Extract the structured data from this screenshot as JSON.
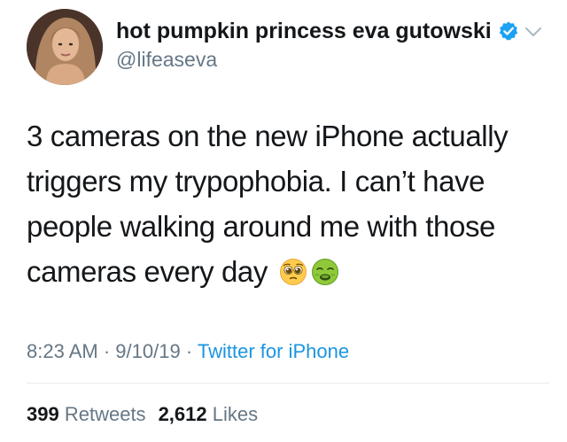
{
  "user": {
    "display_name": "hot pumpkin princess eva gutowski",
    "handle": "@lifeaseva",
    "verified": true,
    "verified_color": "#1da1f2"
  },
  "tweet": {
    "lines": [
      "3 cameras on the new iPhone actually",
      "triggers my trypophobia. I can’t have",
      "people walking around me with those",
      "cameras every day"
    ],
    "emojis": [
      "pleading-face-emoji",
      "nauseated-face-emoji"
    ]
  },
  "meta": {
    "time": "8:23 AM",
    "separator": "·",
    "date": "9/10/19",
    "source": "Twitter for iPhone"
  },
  "stats": {
    "retweets_count": "399",
    "retweets_label": "Retweets",
    "likes_count": "2,612",
    "likes_label": "Likes"
  },
  "colors": {
    "text": "#14171a",
    "secondary": "#657786",
    "link": "#1b95e0",
    "divider": "#e6ecf0"
  }
}
